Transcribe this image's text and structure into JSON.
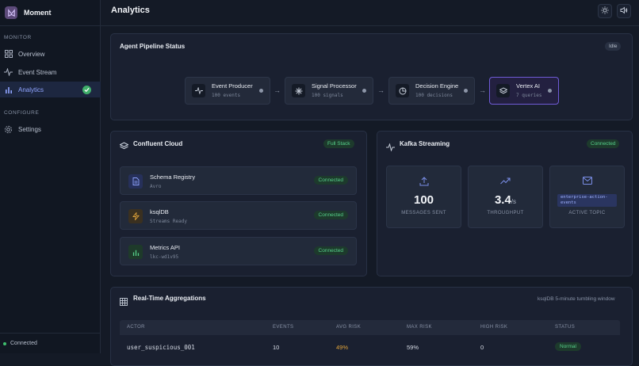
{
  "app": {
    "name": "Moment"
  },
  "sidebar": {
    "sections": [
      {
        "label": "MONITOR"
      },
      {
        "label": "CONFIGURE"
      }
    ],
    "items": [
      {
        "label": "Overview",
        "icon": "grid-icon"
      },
      {
        "label": "Event Stream",
        "icon": "activity-icon"
      },
      {
        "label": "Analytics",
        "icon": "bar-chart-icon",
        "active": true
      },
      {
        "label": "Settings",
        "icon": "gear-icon"
      }
    ],
    "footer": {
      "status": "Connected"
    }
  },
  "header": {
    "title": "Analytics",
    "buttons": [
      "sun-icon",
      "speaker-icon"
    ]
  },
  "pipeline": {
    "title": "Agent Pipeline Status",
    "badge": "Idle",
    "nodes": [
      {
        "title": "Event Producer",
        "sub": "100 events",
        "icon": "activity-icon"
      },
      {
        "title": "Signal Processor",
        "sub": "100 signals",
        "icon": "sparkle-icon"
      },
      {
        "title": "Decision Engine",
        "sub": "100 decisions",
        "icon": "pie-icon"
      },
      {
        "title": "Vertex AI",
        "sub": "7 queries",
        "icon": "layers-icon",
        "active": true
      }
    ],
    "arrow": "→"
  },
  "confluent": {
    "title": "Confluent Cloud",
    "badge": "Full Stack",
    "services": [
      {
        "name": "Schema Registry",
        "sub": "Avro",
        "status": "Connected",
        "icon": "document-icon"
      },
      {
        "name": "ksqlDB",
        "sub": "Streams Ready",
        "status": "Connected",
        "icon": "bolt-icon"
      },
      {
        "name": "Metrics API",
        "sub": "lkc-wd1v95",
        "status": "Connected",
        "icon": "bar-chart-icon"
      }
    ]
  },
  "kafka": {
    "title": "Kafka Streaming",
    "badge": "Connected",
    "stats": [
      {
        "value": "100",
        "unit": "",
        "label": "MESSAGES SENT",
        "icon": "upload-icon"
      },
      {
        "value": "3.4",
        "unit": "/s",
        "label": "THROUGHPUT",
        "icon": "trending-up-icon"
      },
      {
        "value": "enterprise-action-events",
        "label": "ACTIVE TOPIC",
        "icon": "mail-icon"
      }
    ]
  },
  "aggregations": {
    "title": "Real-Time Aggregations",
    "subtitle": "ksqlDB 5-minute tumbling window",
    "columns": [
      "ACTOR",
      "EVENTS",
      "AVG RISK",
      "MAX RISK",
      "HIGH RISK",
      "STATUS"
    ],
    "rows": [
      {
        "actor": "user_suspicious_001",
        "events": "10",
        "avg_risk": "49%",
        "max_risk": "59%",
        "high_risk": "0",
        "status": "Normal"
      }
    ]
  },
  "colors": {
    "accent": "#7b6ef0",
    "success": "#56d18a",
    "warning": "#e0a33a"
  }
}
